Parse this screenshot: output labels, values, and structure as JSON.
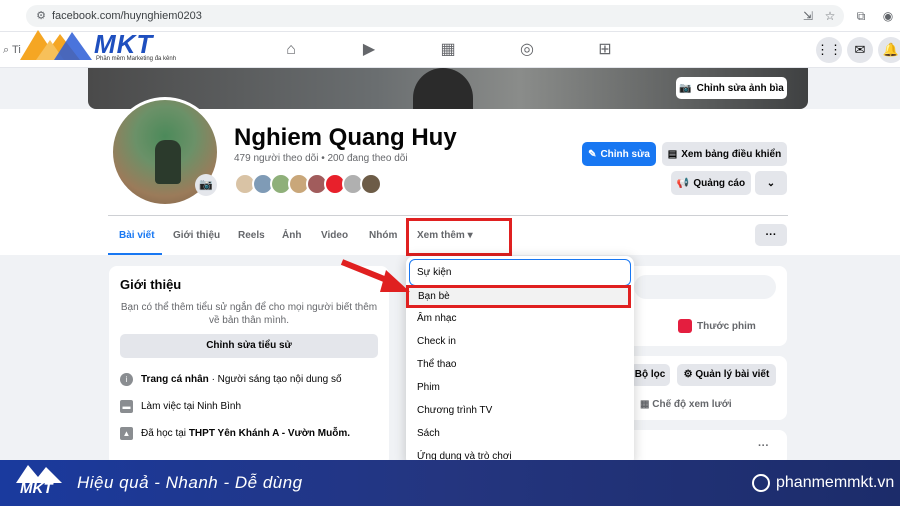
{
  "browser": {
    "url": "facebook.com/huynghiem0203"
  },
  "header": {
    "search_placeholder": "Ti"
  },
  "logo": {
    "brand": "MKT",
    "tagline": "Phần mềm Marketing đa kênh"
  },
  "cover": {
    "edit_label": "Chỉnh sửa ảnh bìa"
  },
  "profile": {
    "name": "Nghiem Quang Huy",
    "followers": "479 người theo dõi • 200 đang theo dõi",
    "edit_label": "Chỉnh sửa",
    "dashboard_label": "Xem bảng điều khiển",
    "ads_label": "Quảng cáo"
  },
  "tabs": [
    "Bài viết",
    "Giới thiệu",
    "Reels",
    "Ảnh",
    "Video",
    "Nhóm",
    "Xem thêm"
  ],
  "dropdown": {
    "items": [
      "Sự kiện",
      "Bạn bè",
      "Âm nhạc",
      "Check in",
      "Thể thao",
      "Phim",
      "Chương trình TV",
      "Sách",
      "Ứng dụng và trò chơi"
    ]
  },
  "intro": {
    "title": "Giới thiệu",
    "description": "Bạn có thể thêm tiểu sử ngắn để cho mọi người biết thêm về bản thân mình.",
    "edit_bio": "Chỉnh sửa tiểu sử",
    "row1_bold": "Trang cá nhân",
    "row1_rest": " · Người sáng tạo nội dung số",
    "row2": "Làm việc tại Ninh Bình",
    "row3_prefix": "Đã học tại ",
    "row3_bold": "THPT Yên Khánh A - Vườn Muỗm."
  },
  "right": {
    "reel_label": "Thước phim",
    "filter_label": "Bộ lọc",
    "manage_posts": "Quản lý bài viết",
    "view_mode": "Chế độ xem lưới"
  },
  "footer": {
    "brand": "MKT",
    "slogan": "Hiệu quả - Nhanh  - Dễ dùng",
    "site": "phanmemmkt.vn"
  }
}
